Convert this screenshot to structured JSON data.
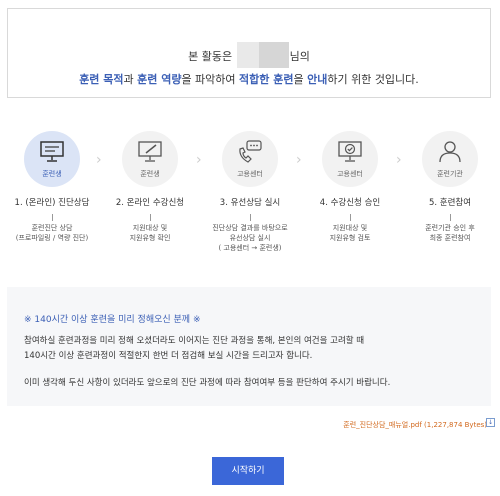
{
  "intro": {
    "line1_prefix": "본 활동은",
    "line1_suffix": "님의",
    "seg1": "훈련 목적",
    "seg2": "과 ",
    "seg3": "훈련 역량",
    "seg4": "을 파악하여 ",
    "seg5": "적합한 훈련",
    "seg6": "을 ",
    "seg7": "안내",
    "seg8": "하기 위한 것입니다."
  },
  "steps": [
    {
      "badge": "훈련생",
      "title": "1. (온라인) 진단상담",
      "desc": "훈련진단 상담\n(프로파일링 / 역량 진단)"
    },
    {
      "badge": "훈련생",
      "title": "2. 온라인 수강신청",
      "desc": "지원대상 및\n지원유형 확인"
    },
    {
      "badge": "고용센터",
      "title": "3. 유선상담 실시",
      "desc": "진단상담 결과를 바탕으로\n유선상담 실시\n( 고용센터 → 훈련생)"
    },
    {
      "badge": "고용센터",
      "title": "4. 수강신청 승인",
      "desc": "지원대상 및\n지원유형 검토"
    },
    {
      "badge": "훈련기관",
      "title": "5. 훈련참여",
      "desc": "훈련기관 승인 후\n최종 훈련참여"
    }
  ],
  "notice": {
    "title": "※ 140시간 이상 훈련을 미리 정해오신 분께 ※",
    "p1": "참여하실 훈련과정을 미리 정해 오셨더라도 이어지는 진단 과정을 통해, 본인의 여건을 고려할 때",
    "p2": "140시간 이상 훈련과정이 적절한지 한번 더 점검해 보실 시간을 드리고자 합니다.",
    "p3": "이미 생각해 두신 사항이 있더라도 앞으로의 진단 과정에 따라 참여여부 등을 판단하여 주시기 바랍니다."
  },
  "file": {
    "label": "훈련_진단상담_매뉴얼.pdf (1,227,874 Bytes)"
  },
  "start_button": "시작하기",
  "colors": {
    "accent": "#3b5fb5",
    "button": "#3b67d8",
    "file_link": "#d2691e"
  }
}
